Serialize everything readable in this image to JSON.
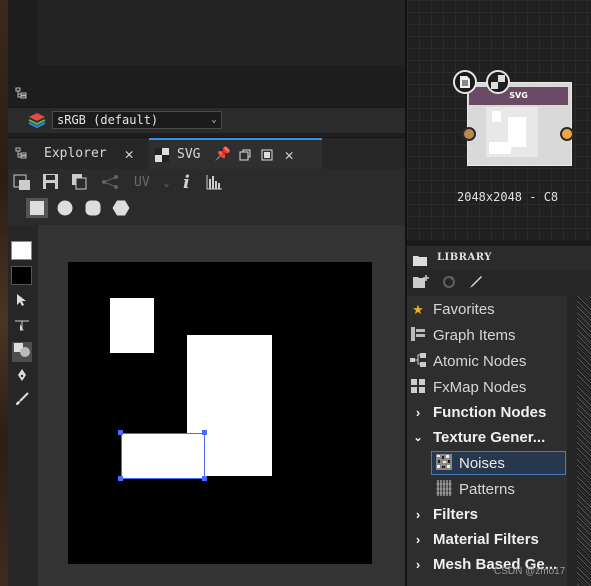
{
  "colorspace": {
    "selected": "sRGB (default)"
  },
  "tabs": [
    {
      "label": "Explorer"
    },
    {
      "label": "SVG"
    }
  ],
  "toolbar": {
    "uv_label": "UV"
  },
  "node": {
    "title": "SVG",
    "resolution": "2048x2048 - C8",
    "port_in_color": "#b88a4f",
    "port_out_color": "#f0a640"
  },
  "library": {
    "title": "LIBRARY",
    "items": [
      {
        "label": "Favorites",
        "icon": "star-icon"
      },
      {
        "label": "Graph Items",
        "icon": "graph-items-icon"
      },
      {
        "label": "Atomic Nodes",
        "icon": "atomic-nodes-icon"
      },
      {
        "label": "FxMap Nodes",
        "icon": "fxmap-icon"
      },
      {
        "label": "Function Nodes",
        "icon": "chevron-right-icon"
      },
      {
        "label": "Texture Gener...",
        "icon": "chevron-down-icon"
      },
      {
        "label": "Noises",
        "icon": "noise-icon"
      },
      {
        "label": "Patterns",
        "icon": "patterns-icon"
      },
      {
        "label": "Filters",
        "icon": "chevron-right-icon"
      },
      {
        "label": "Material Filters",
        "icon": "chevron-right-icon"
      },
      {
        "label": "Mesh Based Ge...",
        "icon": "chevron-right-icon"
      }
    ]
  },
  "watermark": "CSDN @zmo17",
  "colors": {
    "accent": "#3a8ee6",
    "selection_handle": "#4b6bff",
    "node_header": "#6b4a63"
  }
}
